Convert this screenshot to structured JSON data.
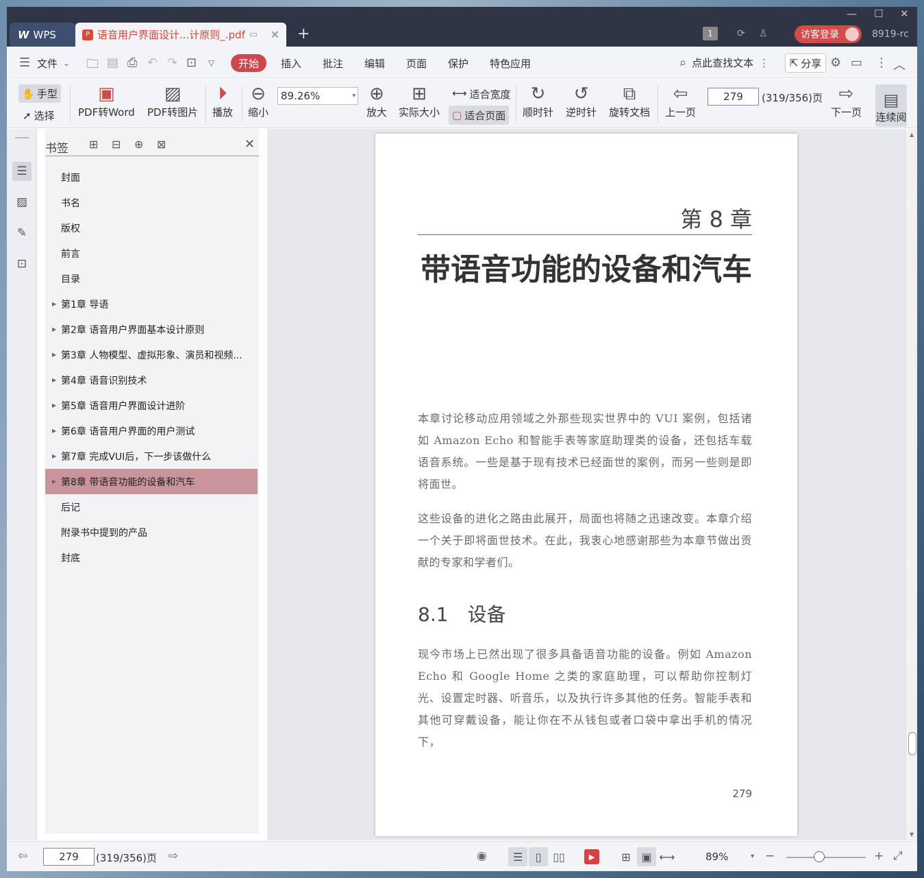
{
  "titlebar": {
    "app_tab": "WPS",
    "doc_tab": "语音用户界面设计...计原则_.pdf",
    "badge": "1",
    "guest_login": "访客登录",
    "user_code": "8919-rc"
  },
  "menubar": {
    "file": "文件",
    "tabs": [
      "开始",
      "插入",
      "批注",
      "编辑",
      "页面",
      "保护",
      "特色应用"
    ],
    "search_hint": "点此查找文本",
    "share": "分享"
  },
  "ribbon": {
    "hand": "手型",
    "select": "选择",
    "pdf_to_word": "PDF转Word",
    "pdf_to_image": "PDF转图片",
    "play": "播放",
    "zoom_out": "缩小",
    "zoom_value": "89.26%",
    "zoom_in": "放大",
    "actual_size": "实际大小",
    "fit_width": "适合宽度",
    "fit_page": "适合页面",
    "clockwise": "顺时针",
    "counterclockwise": "逆时针",
    "rotate_doc": "旋转文档",
    "prev_page": "上一页",
    "page_value": "279",
    "page_total": "(319/356)页",
    "next_page": "下一页",
    "continuous": "连续阅"
  },
  "bookmarks": {
    "title": "书签",
    "items": [
      {
        "label": "封面",
        "expandable": false
      },
      {
        "label": "书名",
        "expandable": false
      },
      {
        "label": "版权",
        "expandable": false
      },
      {
        "label": "前言",
        "expandable": false
      },
      {
        "label": "目录",
        "expandable": false
      },
      {
        "label": "第1章 导语",
        "expandable": true
      },
      {
        "label": "第2章 语音用户界面基本设计原则",
        "expandable": true
      },
      {
        "label": "第3章 人物模型、虚拟形象、演员和视频...",
        "expandable": true
      },
      {
        "label": "第4章 语音识别技术",
        "expandable": true
      },
      {
        "label": "第5章 语音用户界面设计进阶",
        "expandable": true
      },
      {
        "label": "第6章 语音用户界面的用户测试",
        "expandable": true
      },
      {
        "label": "第7章 完成VUI后，下一步该做什么",
        "expandable": true
      },
      {
        "label": "第8章 带语音功能的设备和汽车",
        "expandable": true,
        "active": true
      },
      {
        "label": "后记",
        "expandable": false
      },
      {
        "label": "附录书中提到的产品",
        "expandable": false
      },
      {
        "label": "封底",
        "expandable": false
      }
    ]
  },
  "page": {
    "chapter_no": "第 8 章",
    "chapter_title": "带语音功能的设备和汽车",
    "para1": "本章讨论移动应用领域之外那些现实世界中的 VUI 案例，包括诸如 Amazon Echo 和智能手表等家庭助理类的设备，还包括车载语音系统。一些是基于现有技术已经面世的案例，而另一些则是即将面世。",
    "para2": "这些设备的进化之路由此展开，局面也将随之迅速改变。本章介绍一个关于即将面世技术。在此，我衷心地感谢那些为本章节做出贡献的专家和学者们。",
    "section_heading": "8.1　设备",
    "para3": "现今市场上已然出现了很多具备语音功能的设备。例如 Amazon Echo 和 Google Home 之类的家庭助理，可以帮助你控制灯光、设置定时器、听音乐，以及执行许多其他的任务。智能手表和其他可穿戴设备，能让你在不从钱包或者口袋中拿出手机的情况下，",
    "page_number": "279"
  },
  "statusbar": {
    "page_value": "279",
    "page_total": "(319/356)页",
    "zoom": "89%"
  },
  "colors": {
    "accent": "#d0464d",
    "titlebar_bg": "#2f3545",
    "bookmark_active": "#c9949c"
  }
}
